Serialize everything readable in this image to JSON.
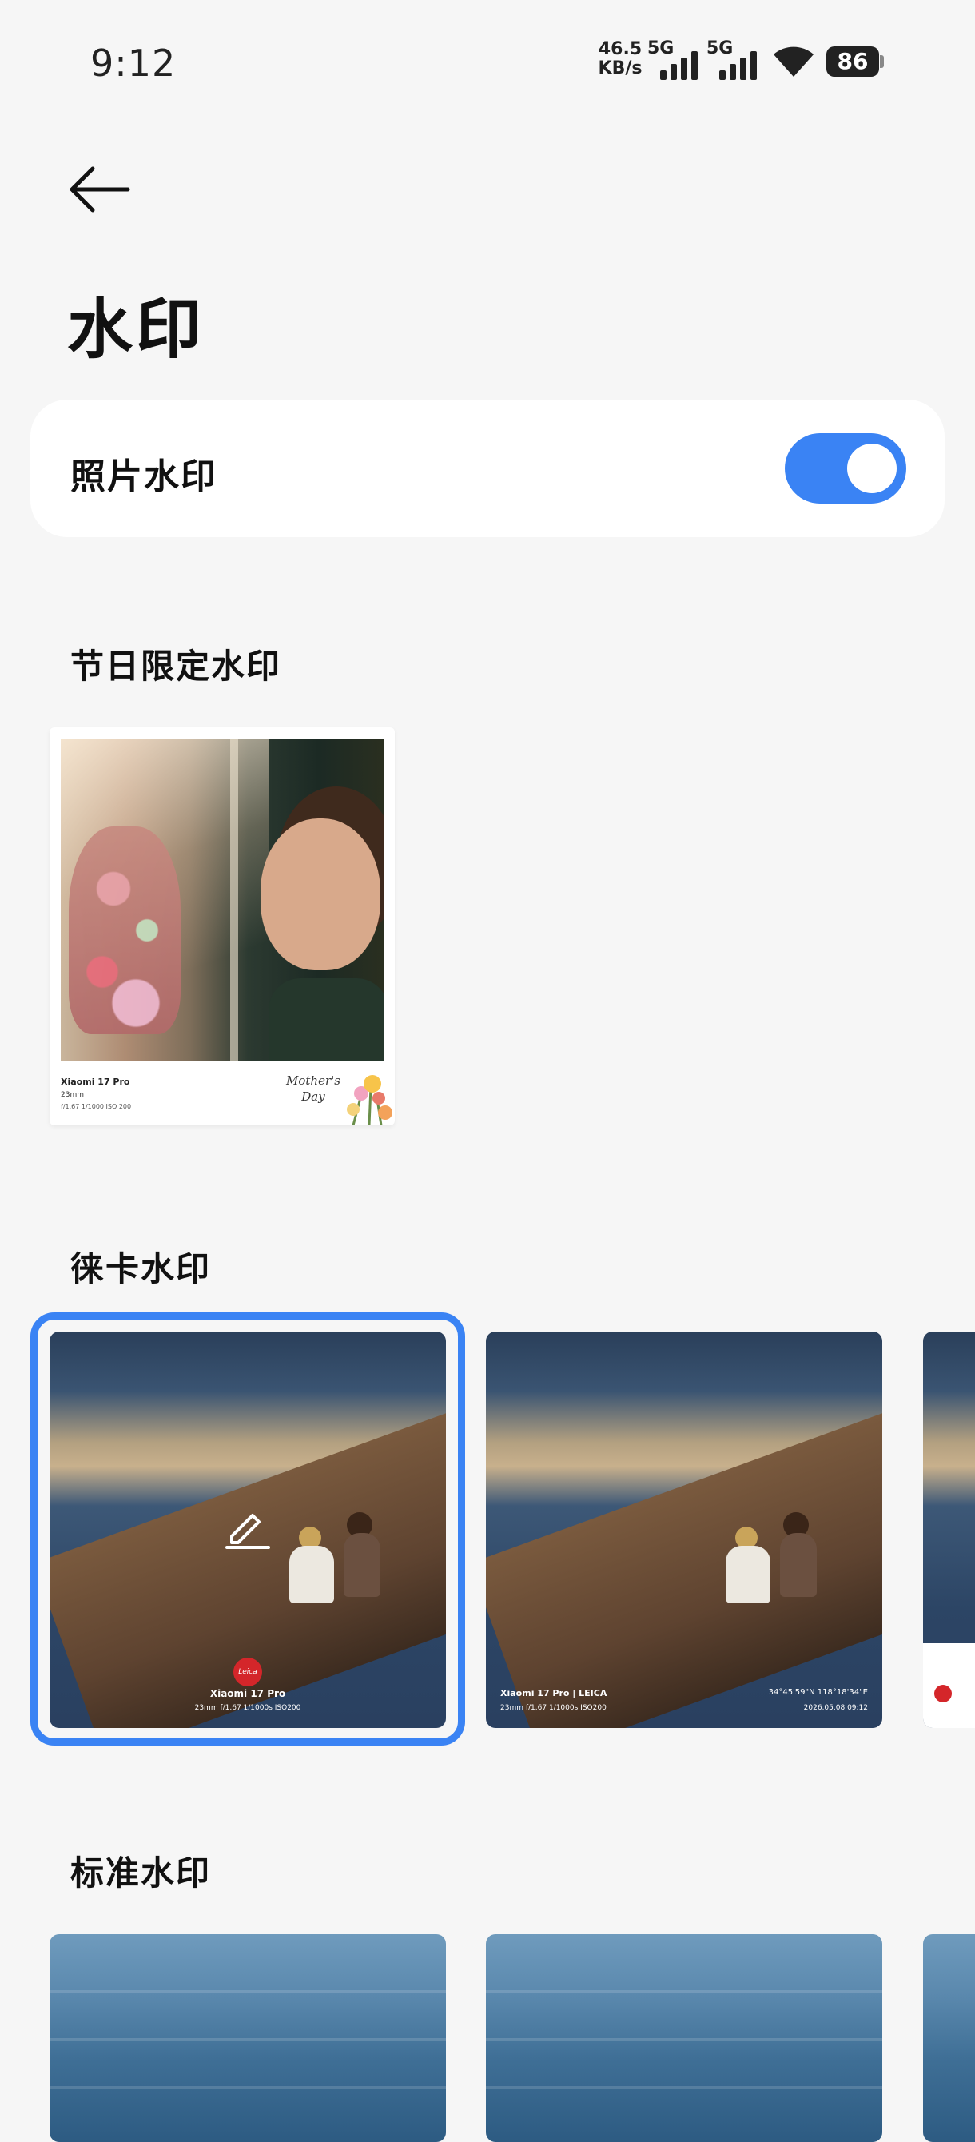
{
  "status_bar": {
    "time": "9:12",
    "net_speed_value": "46.5",
    "net_speed_unit": "KB/s",
    "sim1_label": "5G",
    "sim2_label": "5G",
    "battery": "86"
  },
  "header": {
    "back_icon": "arrow-left-icon",
    "title": "水印"
  },
  "settings": {
    "photo_watermark_label": "照片水印",
    "photo_watermark_enabled": true,
    "accent_color": "#3a83f4"
  },
  "sections": {
    "holiday_title": "节日限定水印",
    "leica_title": "徕卡水印",
    "standard_title": "标准水印"
  },
  "holiday_frame": {
    "brand": "Xiaomi 17 Pro",
    "focal": "23mm",
    "params": "f/1.67  1/1000  ISO 200",
    "greeting_line1": "Mother's",
    "greeting_line2": "Day"
  },
  "leica_frames": [
    {
      "selected": true,
      "logo": "Leica",
      "brand": "Xiaomi 17 Pro",
      "params": "23mm  f/1.67  1/1000s  ISO200"
    },
    {
      "selected": false,
      "brand": "Xiaomi 17 Pro | LEICA",
      "params": "23mm  f/1.67  1/1000s  ISO200",
      "coords": "34°45'59\"N  118°18'34\"E",
      "datetime": "2026.05.08 09:12"
    }
  ]
}
